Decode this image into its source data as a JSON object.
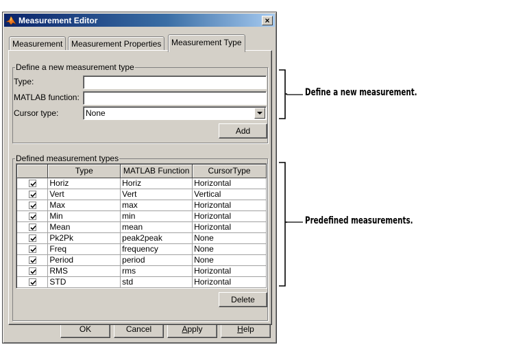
{
  "window": {
    "title": "Measurement Editor",
    "close_glyph": "×"
  },
  "tabs": [
    {
      "label": "Measurement",
      "active": false
    },
    {
      "label": "Measurement Properties",
      "active": false
    },
    {
      "label": "Measurement Type",
      "active": true
    }
  ],
  "define_group": {
    "legend": "Define a new measurement type",
    "type_label": "Type:",
    "type_value": "",
    "function_label": "MATLAB function:",
    "function_value": "",
    "cursor_label": "Cursor type:",
    "cursor_value": "None",
    "add_label": "Add"
  },
  "defined_group": {
    "legend": "Defined measurement types",
    "columns": [
      "",
      "Type",
      "MATLAB Function",
      "CursorType"
    ],
    "rows": [
      {
        "checked": true,
        "type": "Horiz",
        "function": "Horiz",
        "cursor": "Horizontal"
      },
      {
        "checked": true,
        "type": "Vert",
        "function": "Vert",
        "cursor": "Vertical"
      },
      {
        "checked": true,
        "type": "Max",
        "function": "max",
        "cursor": "Horizontal"
      },
      {
        "checked": true,
        "type": "Min",
        "function": "min",
        "cursor": "Horizontal"
      },
      {
        "checked": true,
        "type": "Mean",
        "function": "mean",
        "cursor": "Horizontal"
      },
      {
        "checked": true,
        "type": "Pk2Pk",
        "function": "peak2peak",
        "cursor": "None"
      },
      {
        "checked": true,
        "type": "Freq",
        "function": "frequency",
        "cursor": "None"
      },
      {
        "checked": true,
        "type": "Period",
        "function": "period",
        "cursor": "None"
      },
      {
        "checked": true,
        "type": "RMS",
        "function": "rms",
        "cursor": "Horizontal"
      },
      {
        "checked": true,
        "type": "STD",
        "function": "std",
        "cursor": "Horizontal"
      }
    ],
    "delete_label": "Delete"
  },
  "buttons": {
    "ok": "OK",
    "cancel": "Cancel",
    "apply_mnemonic": "A",
    "apply_rest": "pply",
    "help_mnemonic": "H",
    "help_rest": "elp"
  },
  "annotations": {
    "define": "Define a new measurement.",
    "predefined": "Predefined measurements."
  },
  "colors": {
    "titlebar_start": "#0a246a",
    "titlebar_end": "#a6caf0",
    "dialog_face": "#d4d0c8"
  }
}
